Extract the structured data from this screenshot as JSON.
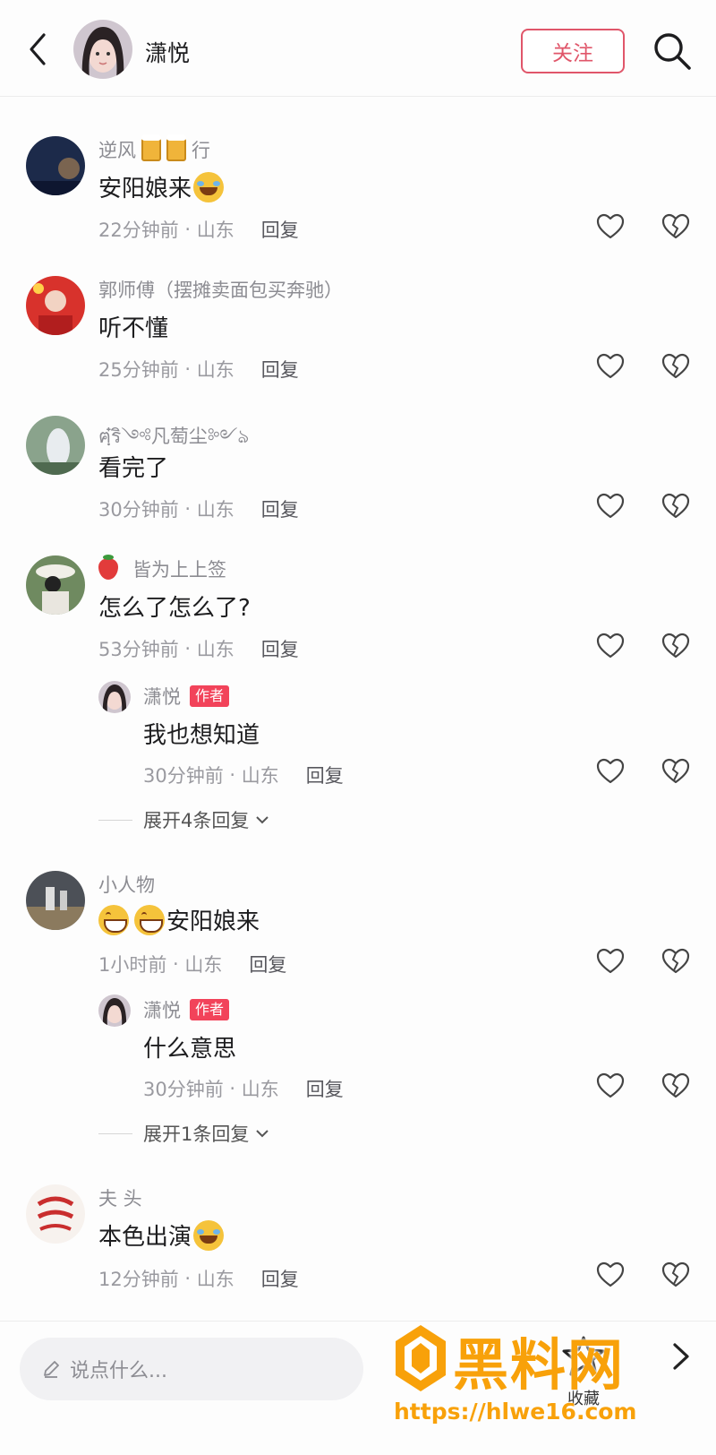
{
  "header": {
    "username": "潇悦",
    "follow_label": "关注"
  },
  "comments": [
    {
      "username": "逆风",
      "username_suffix": "行",
      "text": "安阳娘来",
      "time": "22分钟前",
      "location": "山东",
      "reply_label": "回复"
    },
    {
      "username": "郭师傅（摆摊卖面包买奔驰）",
      "text": "听不懂",
      "time": "25分钟前",
      "location": "山东",
      "reply_label": "回复"
    },
    {
      "username": "ฅฺ๋ริ༺凡萄尘༻ঌ",
      "text": "看完了",
      "time": "30分钟前",
      "location": "山东",
      "reply_label": "回复"
    },
    {
      "username": "皆为上上签",
      "text": "怎么了怎么了?",
      "time": "53分钟前",
      "location": "山东",
      "reply_label": "回复",
      "reply": {
        "username": "潇悦",
        "badge": "作者",
        "text": "我也想知道",
        "time": "30分钟前",
        "location": "山东",
        "reply_label": "回复"
      },
      "expand_label": "展开4条回复"
    },
    {
      "username": "小人物",
      "text": "安阳娘来",
      "time": "1小时前",
      "location": "山东",
      "reply_label": "回复",
      "reply": {
        "username": "潇悦",
        "badge": "作者",
        "text": "什么意思",
        "time": "30分钟前",
        "location": "山东",
        "reply_label": "回复"
      },
      "expand_label": "展开1条回复"
    },
    {
      "username": "夫 头",
      "text": "本色出演",
      "time": "12分钟前",
      "location": "山东",
      "reply_label": "回复"
    }
  ],
  "bottom": {
    "input_placeholder": "说点什么...",
    "collect_label": "收藏"
  },
  "watermark": {
    "title": "黑料网",
    "url": "https://hlwe16.com"
  }
}
